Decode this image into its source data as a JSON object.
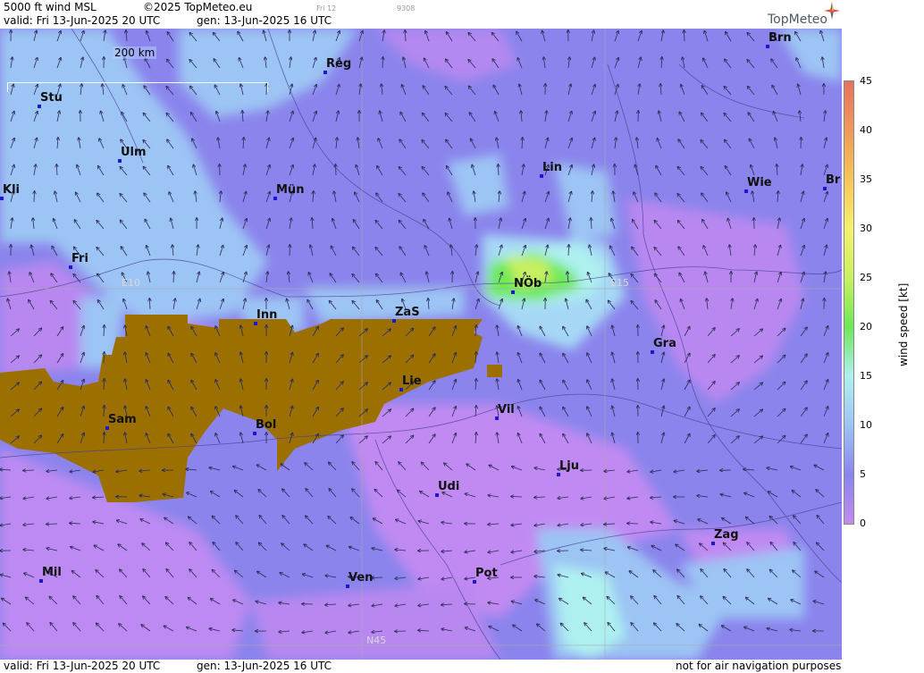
{
  "header": {
    "product": "5000 ft wind MSL",
    "copyright": "©2025 TopMeteo.eu",
    "valid": "valid:  Fri  13-Jun-2025  20 UTC",
    "generated": "gen: 13-Jun-2025 16 UTC",
    "tiny_label_1": "Fri 12",
    "tiny_label_2": "9308",
    "logo": "TopMeteo"
  },
  "footer": {
    "valid": "valid:  Fri  13-Jun-2025  20 UTC",
    "generated": "gen: 13-Jun-2025 16 UTC",
    "disclaimer": "not for air navigation purposes"
  },
  "scale_bar": {
    "label": "200 km"
  },
  "grid_labels": {
    "e10": "E10",
    "e15": "E15",
    "n45": "N45"
  },
  "cities": [
    {
      "id": "stu",
      "name": "Stu"
    },
    {
      "id": "reg",
      "name": "Reg"
    },
    {
      "id": "brn",
      "name": "Brn"
    },
    {
      "id": "ulm",
      "name": "Ulm"
    },
    {
      "id": "kli",
      "name": "Kli"
    },
    {
      "id": "mun",
      "name": "Mün"
    },
    {
      "id": "lin",
      "name": "Lin"
    },
    {
      "id": "wie",
      "name": "Wie"
    },
    {
      "id": "br",
      "name": "Br"
    },
    {
      "id": "fri",
      "name": "Fri"
    },
    {
      "id": "nob",
      "name": "NÖb"
    },
    {
      "id": "inn",
      "name": "Inn"
    },
    {
      "id": "zas",
      "name": "ZaS"
    },
    {
      "id": "gra",
      "name": "Gra"
    },
    {
      "id": "lie",
      "name": "Lie"
    },
    {
      "id": "vil",
      "name": "Vil"
    },
    {
      "id": "sam",
      "name": "Sam"
    },
    {
      "id": "bol",
      "name": "Bol"
    },
    {
      "id": "lju",
      "name": "Lju"
    },
    {
      "id": "udi",
      "name": "Udi"
    },
    {
      "id": "zag",
      "name": "Zag"
    },
    {
      "id": "mil",
      "name": "Mil"
    },
    {
      "id": "pot",
      "name": "Pot"
    },
    {
      "id": "ven",
      "name": "Ven"
    }
  ],
  "legend": {
    "title": "wind  speed  [kt]",
    "ticks": [
      "45",
      "40",
      "35",
      "30",
      "25",
      "20",
      "15",
      "10",
      "5",
      "0"
    ],
    "colors": [
      "#e87060",
      "#f09a58",
      "#f6c558",
      "#f6f070",
      "#c8f060",
      "#6ee858",
      "#aef0f0",
      "#9cc4f4",
      "#8a84ee",
      "#c28af2"
    ]
  },
  "palette": {
    "violet_light": "#c08af0",
    "violet_mid": "#9a88ee",
    "blue_violet": "#8a84ec",
    "light_blue": "#9cc4f4",
    "cyan": "#aef0f0",
    "green": "#6ee858",
    "yellow_green": "#c8f060",
    "terrain_mask": "#9b7000"
  }
}
